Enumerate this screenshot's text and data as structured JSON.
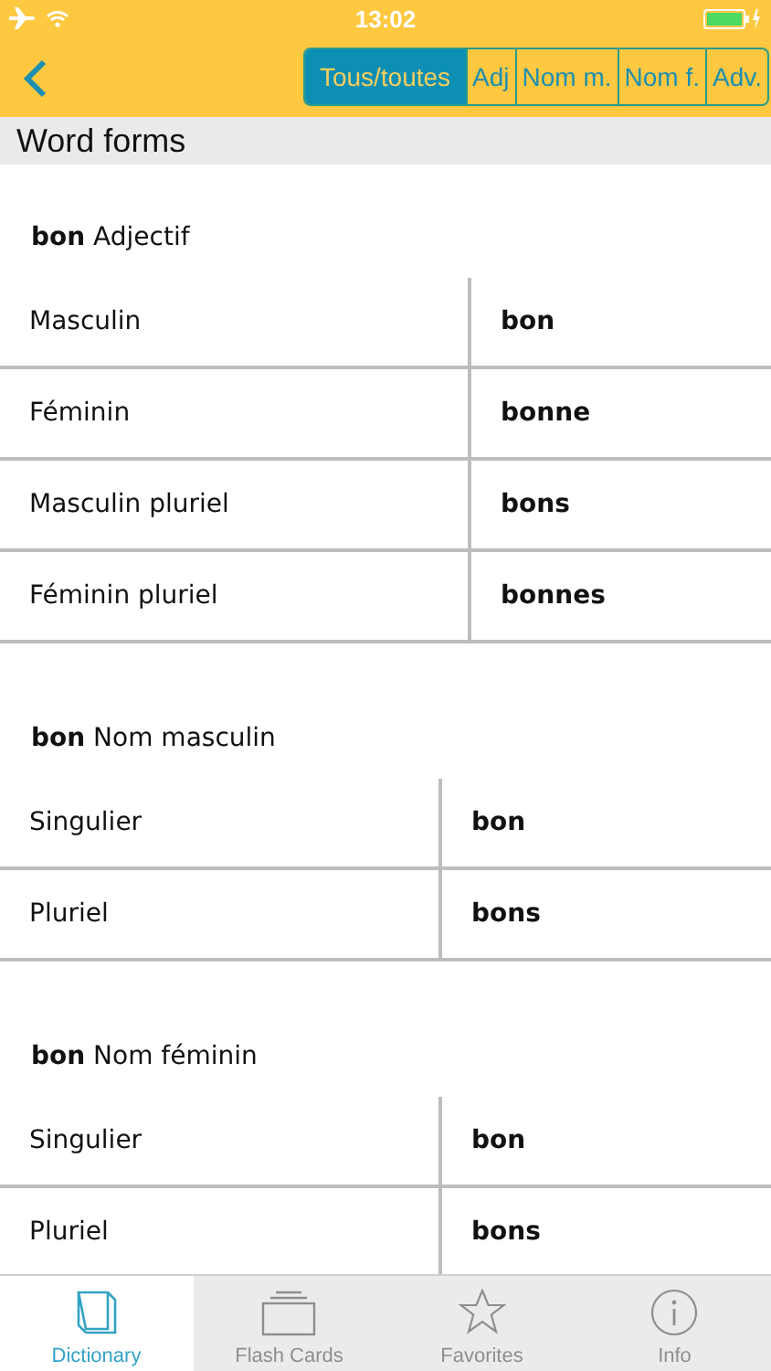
{
  "status_bar": {
    "time": "13:02"
  },
  "segments": [
    {
      "label": "Tous/toutes",
      "selected": true
    },
    {
      "label": "Adj",
      "selected": false
    },
    {
      "label": "Nom m.",
      "selected": false
    },
    {
      "label": "Nom f.",
      "selected": false
    },
    {
      "label": "Adv.",
      "selected": false
    }
  ],
  "section_title": "Word forms",
  "groups": [
    {
      "heading": "**bon** Adjectif",
      "rows": [
        {
          "form": "Masculin",
          "word": "bon"
        },
        {
          "form": "Féminin",
          "word": "bonne"
        },
        {
          "form": "Masculin pluriel",
          "word": "bons"
        },
        {
          "form": "Féminin pluriel",
          "word": "bonnes"
        }
      ]
    },
    {
      "heading": "**bon** Nom masculin",
      "rows": [
        {
          "form": "Singulier",
          "word": "bon"
        },
        {
          "form": "Pluriel",
          "word": "bons"
        }
      ]
    },
    {
      "heading": "**bon** Nom féminin",
      "rows": [
        {
          "form": "Singulier",
          "word": "bon"
        },
        {
          "form": "Pluriel",
          "word": "bons"
        }
      ]
    }
  ],
  "tab_bar": [
    {
      "kind": "book",
      "label": "Dictionary",
      "selected": true
    },
    {
      "kind": "cards",
      "label": "Flash Cards",
      "selected": false
    },
    {
      "kind": "star",
      "label": "Favorites",
      "selected": false
    },
    {
      "kind": "info",
      "label": "Info",
      "selected": false
    }
  ]
}
